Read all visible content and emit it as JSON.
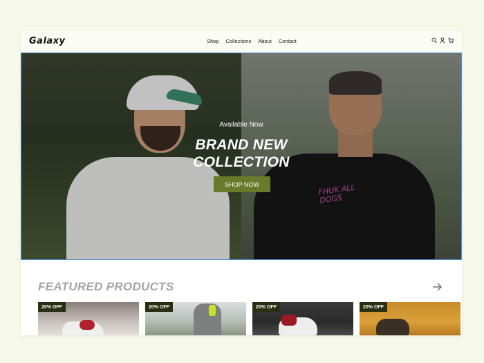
{
  "brand": {
    "logo": "Galaxy"
  },
  "nav": {
    "items": [
      {
        "label": "Shop"
      },
      {
        "label": "Collections"
      },
      {
        "label": "About"
      },
      {
        "label": "Contact"
      }
    ]
  },
  "header_icons": [
    "search-icon",
    "user-icon",
    "cart-icon"
  ],
  "hero": {
    "subtitle": "Available Now",
    "title_line1": "BRAND NEW",
    "title_line2": "COLLECTION",
    "cta_label": "SHOP NOW",
    "shirt_print": "FHUK ALL DOGS"
  },
  "featured": {
    "title": "FEATURED PRODUCTS",
    "products": [
      {
        "badge": "20% OFF"
      },
      {
        "badge": "20% OFF"
      },
      {
        "badge": "20% OFF"
      },
      {
        "badge": "20% OFF"
      }
    ]
  },
  "colors": {
    "page_bg": "#f6f8e8",
    "cta": "#6b7a2a",
    "badge": "#2a2e10",
    "featured_title": "#a4a4a4"
  }
}
